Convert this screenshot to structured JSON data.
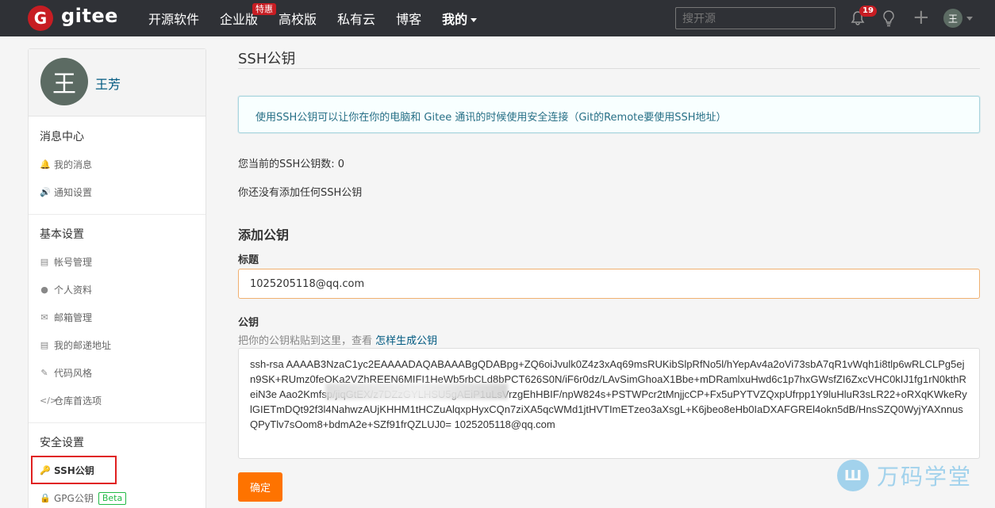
{
  "topbar": {
    "logo_letter": "G",
    "logo_text": "gitee",
    "nav": [
      "开源软件",
      "企业版",
      "高校版",
      "私有云",
      "博客",
      "我的"
    ],
    "promo_badge": "特惠",
    "search_placeholder": "搜开源",
    "notification_count": "19",
    "plus": "+",
    "avatar_char": "王"
  },
  "sidebar": {
    "avatar_char": "王",
    "username": "王芳",
    "sections": [
      {
        "title": "消息中心",
        "items": [
          {
            "icon": "bell-icon",
            "label": "我的消息"
          },
          {
            "icon": "speaker-icon",
            "label": "通知设置"
          }
        ]
      },
      {
        "title": "基本设置",
        "items": [
          {
            "icon": "id-card-icon",
            "label": "帐号管理"
          },
          {
            "icon": "user-icon",
            "label": "个人资料"
          },
          {
            "icon": "envelope-icon",
            "label": "邮箱管理"
          },
          {
            "icon": "id-card-icon",
            "label": "我的邮递地址"
          },
          {
            "icon": "brush-icon",
            "label": "代码风格"
          },
          {
            "icon": "code-icon",
            "label": "仓库首选项"
          }
        ]
      },
      {
        "title": "安全设置",
        "items": [
          {
            "icon": "key-icon",
            "label": "SSH公钥"
          },
          {
            "icon": "lock-icon",
            "label": "GPG公钥"
          }
        ]
      }
    ],
    "beta_badge": "Beta"
  },
  "main": {
    "title": "SSH公钥",
    "info": "使用SSH公钥可以让你在你的电脑和 Gitee 通讯的时候使用安全连接（Git的Remote要使用SSH地址）",
    "count_text": "您当前的SSH公钥数: 0",
    "empty_text": "你还没有添加任何SSH公钥",
    "add_title": "添加公钥",
    "title_label": "标题",
    "title_value": "1025205118@qq.com",
    "key_label": "公钥",
    "key_hint": "把你的公钥粘贴到这里，查看 ",
    "key_hint_link": "怎样生成公钥",
    "key_value": "ssh-rsa AAAAB3NzaC1yc2EAAAADAQABAAABgQDABpg+ZQ6oiJvulk0Z4z3xAq69msRUKibSlpRfNo5l/hYepAv4a2oVi73sbA7qR1vWqh1i8tlp6wRLCLPg5ejn9SK+RUmz0feOKa2VZhREEN6MIFI1HeWb5rbCLd8bPCT626S0N/iF6r0dz/LAvSimGhoaX1Bbe+mDRamlxuHwd6c1p7hxGWsfZI6ZxcVHC0kIJ1fg1rN0kthReiN3e                                          Aao2Kmfsp/jiqGtEX/z7DZzGYLHSU5gAEiP1uLsVrzgEhHBIF/npW824s+PSTWPcr2tMnjjcCP+Fx5uPYTVZQxpUfrpp1Y9luHluR3sLR22+oRXqKWkeRylGIETmDQt92f3l4NahwzAUjKHHM1tHCZuAlqxpHyxCQn7ziXA5qcWMd1jtHVTImETzeo3aXsgL+K6jbeo8eHb0IaDXAFGREl4okn5dB/HnsSZQ0WyjYAXnnusQPyTlv7sOom8+bdmA2e+SZf91frQZLUJ0= 1025205118@qq.com",
    "submit_label": "确定"
  },
  "watermark": {
    "icon_text": "Ш",
    "text": "万码学堂"
  }
}
